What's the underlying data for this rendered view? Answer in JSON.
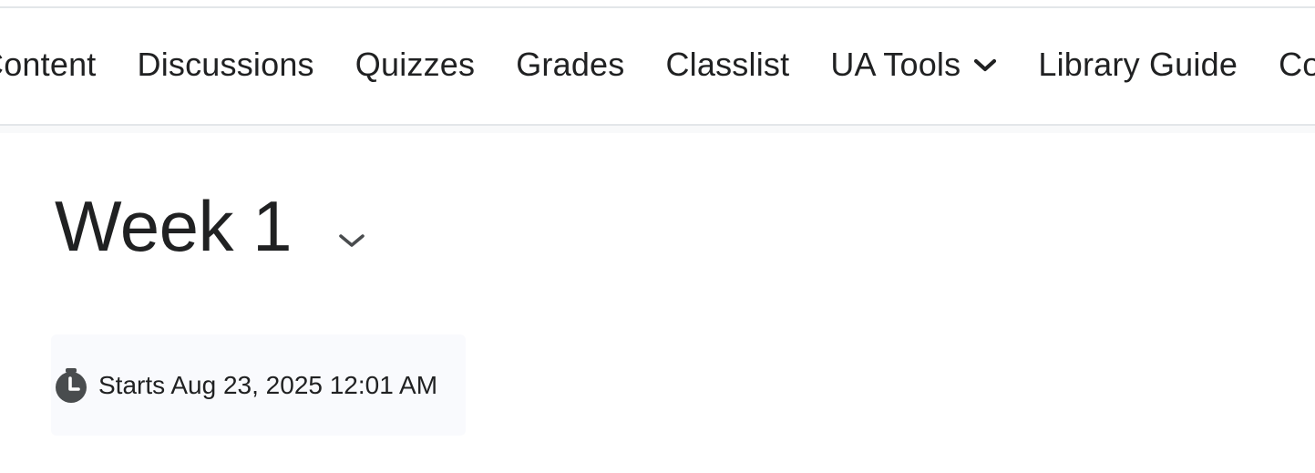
{
  "nav": {
    "items": [
      {
        "label": "Content"
      },
      {
        "label": "Discussions"
      },
      {
        "label": "Quizzes"
      },
      {
        "label": "Grades"
      },
      {
        "label": "Classlist"
      },
      {
        "label": "UA Tools",
        "icon": "chevron-down-icon"
      },
      {
        "label": "Library Guide"
      },
      {
        "label": "Course"
      }
    ]
  },
  "module": {
    "title": "Week 1",
    "title_menu_icon": "chevron-down-icon",
    "availability_icon": "clock-icon",
    "availability_text": "Starts Aug 23, 2025 12:01 AM"
  }
}
